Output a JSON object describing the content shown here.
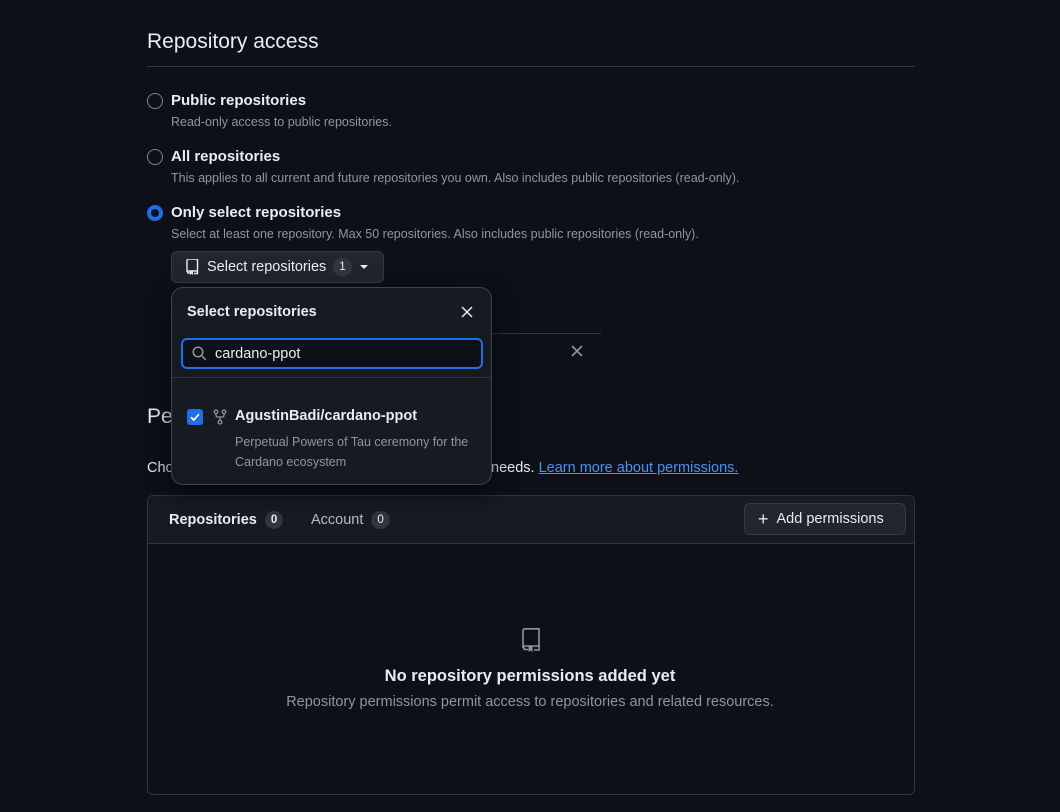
{
  "repository_access": {
    "title": "Repository access",
    "options": [
      {
        "label": "Public repositories",
        "description": "Read-only access to public repositories.",
        "checked": false
      },
      {
        "label": "All repositories",
        "description": "This applies to all current and future repositories you own. Also includes public repositories (read-only).",
        "checked": false
      },
      {
        "label": "Only select repositories",
        "description": "Select at least one repository. Max 50 repositories. Also includes public repositories (read-only).",
        "checked": true
      }
    ],
    "select_button": {
      "label": "Select repositories",
      "count": "1",
      "icon": "repo-icon"
    }
  },
  "popover": {
    "title": "Select repositories",
    "search_value": "cardano-ppot",
    "items": [
      {
        "name": "AgustinBadi/cardano-ppot",
        "description": "Perpetual Powers of Tau ceremony for the Cardano ecosystem",
        "checked": true,
        "icon": "repo-forked-icon"
      }
    ]
  },
  "permissions": {
    "title_visible": "Pe",
    "desc_left": "Cho",
    "desc_right": "needs.",
    "learn_more": "Learn more about permissions.",
    "tabs": [
      {
        "label": "Repositories",
        "count": "0"
      },
      {
        "label": "Account",
        "count": "0"
      }
    ],
    "add_button": "Add permissions",
    "empty": {
      "title": "No repository permissions added yet",
      "description": "Repository permissions permit access to repositories and related resources."
    }
  },
  "colors": {
    "accent": "#1f6feb",
    "link": "#4493f8",
    "background": "#0d1117"
  }
}
